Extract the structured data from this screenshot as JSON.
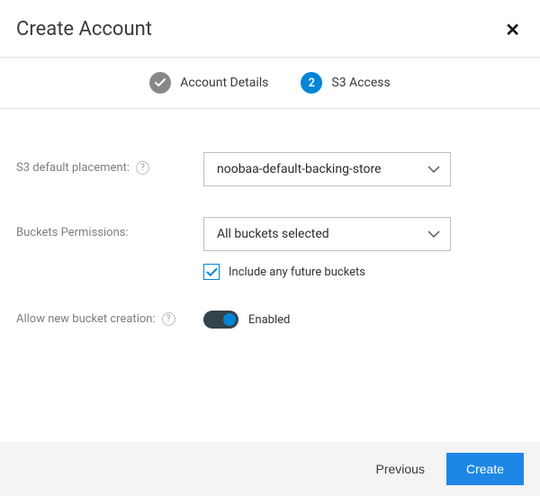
{
  "header": {
    "title": "Create Account"
  },
  "steps": {
    "step1": {
      "label": "Account Details"
    },
    "step2": {
      "number": "2",
      "label": "S3 Access"
    }
  },
  "form": {
    "placement": {
      "label": "S3 default placement:",
      "value": "noobaa-default-backing-store"
    },
    "buckets": {
      "label": "Buckets Permissions:",
      "value": "All buckets selected",
      "include_future_label": "Include any future buckets"
    },
    "new_bucket": {
      "label": "Allow new bucket creation:",
      "state_label": "Enabled"
    }
  },
  "footer": {
    "previous": "Previous",
    "create": "Create"
  }
}
